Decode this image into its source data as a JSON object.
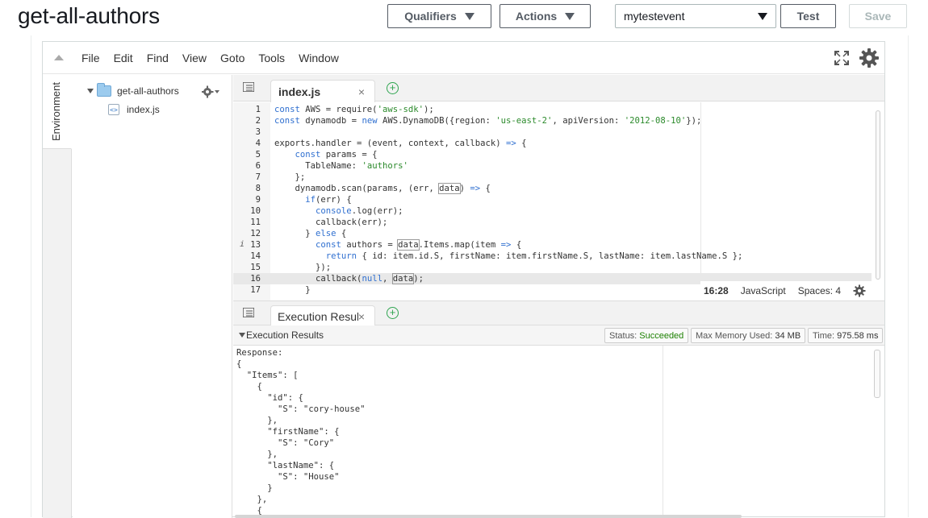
{
  "header": {
    "title": "get-all-authors",
    "qualifiers_label": "Qualifiers",
    "actions_label": "Actions",
    "test_event": "mytestevent",
    "test_label": "Test",
    "save_label": "Save"
  },
  "menubar": {
    "items": [
      "File",
      "Edit",
      "Find",
      "View",
      "Goto",
      "Tools",
      "Window"
    ]
  },
  "sidebar": {
    "env_tab": "Environment",
    "folder": "get-all-authors",
    "file": "index.js",
    "file_icon": "<>"
  },
  "editor": {
    "tab_label": "index.js",
    "close": "×",
    "add": "+",
    "lines": [
      {
        "n": "1",
        "t": "const AWS = require('aws-sdk');"
      },
      {
        "n": "2",
        "t": "const dynamodb = new AWS.DynamoDB({region: 'us-east-2', apiVersion: '2012-08-10'});"
      },
      {
        "n": "3",
        "t": ""
      },
      {
        "n": "4",
        "t": "exports.handler = (event, context, callback) => {"
      },
      {
        "n": "5",
        "t": "    const params = {"
      },
      {
        "n": "6",
        "t": "      TableName: 'authors'"
      },
      {
        "n": "7",
        "t": "    };"
      },
      {
        "n": "8",
        "t": "    dynamodb.scan(params, (err, data) => {"
      },
      {
        "n": "9",
        "t": "      if(err) {"
      },
      {
        "n": "10",
        "t": "        console.log(err);"
      },
      {
        "n": "11",
        "t": "        callback(err);"
      },
      {
        "n": "12",
        "t": "      } else {"
      },
      {
        "n": "13",
        "t": "        const authors = data.Items.map(item => {"
      },
      {
        "n": "14",
        "t": "          return { id: item.id.S, firstName: item.firstName.S, lastName: item.lastName.S };"
      },
      {
        "n": "15",
        "t": "        });"
      },
      {
        "n": "16",
        "t": "        callback(null, data);"
      },
      {
        "n": "17",
        "t": "      }"
      }
    ],
    "info_marker": "i"
  },
  "statusbar": {
    "position": "16:28",
    "language": "JavaScript",
    "spaces": "Spaces: 4"
  },
  "results": {
    "tab_label": "Execution Results",
    "close": "×",
    "add": "+",
    "header": "Execution Results",
    "status_label": "Status:",
    "status_value": "Succeeded",
    "memory_label": "Max Memory Used:",
    "memory_value": "34 MB",
    "time_label": "Time:",
    "time_value": "975.58 ms",
    "lines": [
      "Response:",
      "{",
      "  \"Items\": [",
      "    {",
      "      \"id\": {",
      "        \"S\": \"cory-house\"",
      "      },",
      "      \"firstName\": {",
      "        \"S\": \"Cory\"",
      "      },",
      "      \"lastName\": {",
      "        \"S\": \"House\"",
      "      }",
      "    },",
      "    {"
    ]
  },
  "colors": {
    "success": "#1d8102",
    "keyword": "#3070d0",
    "string": "#2b8a2b",
    "add_button": "#2ea44f"
  }
}
